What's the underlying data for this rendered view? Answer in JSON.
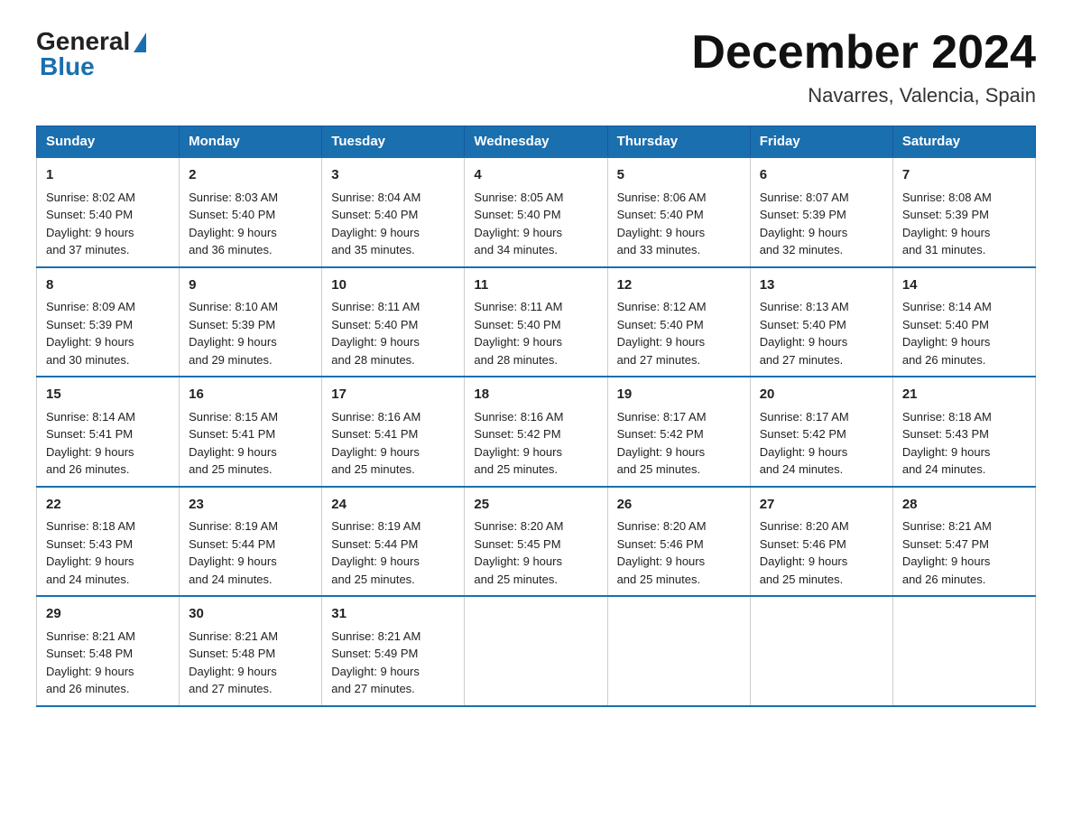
{
  "logo": {
    "general": "General",
    "blue": "Blue"
  },
  "title": {
    "month_year": "December 2024",
    "location": "Navarres, Valencia, Spain"
  },
  "headers": [
    "Sunday",
    "Monday",
    "Tuesday",
    "Wednesday",
    "Thursday",
    "Friday",
    "Saturday"
  ],
  "weeks": [
    [
      {
        "day": "1",
        "sunrise": "8:02 AM",
        "sunset": "5:40 PM",
        "daylight": "9 hours and 37 minutes."
      },
      {
        "day": "2",
        "sunrise": "8:03 AM",
        "sunset": "5:40 PM",
        "daylight": "9 hours and 36 minutes."
      },
      {
        "day": "3",
        "sunrise": "8:04 AM",
        "sunset": "5:40 PM",
        "daylight": "9 hours and 35 minutes."
      },
      {
        "day": "4",
        "sunrise": "8:05 AM",
        "sunset": "5:40 PM",
        "daylight": "9 hours and 34 minutes."
      },
      {
        "day": "5",
        "sunrise": "8:06 AM",
        "sunset": "5:40 PM",
        "daylight": "9 hours and 33 minutes."
      },
      {
        "day": "6",
        "sunrise": "8:07 AM",
        "sunset": "5:39 PM",
        "daylight": "9 hours and 32 minutes."
      },
      {
        "day": "7",
        "sunrise": "8:08 AM",
        "sunset": "5:39 PM",
        "daylight": "9 hours and 31 minutes."
      }
    ],
    [
      {
        "day": "8",
        "sunrise": "8:09 AM",
        "sunset": "5:39 PM",
        "daylight": "9 hours and 30 minutes."
      },
      {
        "day": "9",
        "sunrise": "8:10 AM",
        "sunset": "5:39 PM",
        "daylight": "9 hours and 29 minutes."
      },
      {
        "day": "10",
        "sunrise": "8:11 AM",
        "sunset": "5:40 PM",
        "daylight": "9 hours and 28 minutes."
      },
      {
        "day": "11",
        "sunrise": "8:11 AM",
        "sunset": "5:40 PM",
        "daylight": "9 hours and 28 minutes."
      },
      {
        "day": "12",
        "sunrise": "8:12 AM",
        "sunset": "5:40 PM",
        "daylight": "9 hours and 27 minutes."
      },
      {
        "day": "13",
        "sunrise": "8:13 AM",
        "sunset": "5:40 PM",
        "daylight": "9 hours and 27 minutes."
      },
      {
        "day": "14",
        "sunrise": "8:14 AM",
        "sunset": "5:40 PM",
        "daylight": "9 hours and 26 minutes."
      }
    ],
    [
      {
        "day": "15",
        "sunrise": "8:14 AM",
        "sunset": "5:41 PM",
        "daylight": "9 hours and 26 minutes."
      },
      {
        "day": "16",
        "sunrise": "8:15 AM",
        "sunset": "5:41 PM",
        "daylight": "9 hours and 25 minutes."
      },
      {
        "day": "17",
        "sunrise": "8:16 AM",
        "sunset": "5:41 PM",
        "daylight": "9 hours and 25 minutes."
      },
      {
        "day": "18",
        "sunrise": "8:16 AM",
        "sunset": "5:42 PM",
        "daylight": "9 hours and 25 minutes."
      },
      {
        "day": "19",
        "sunrise": "8:17 AM",
        "sunset": "5:42 PM",
        "daylight": "9 hours and 25 minutes."
      },
      {
        "day": "20",
        "sunrise": "8:17 AM",
        "sunset": "5:42 PM",
        "daylight": "9 hours and 24 minutes."
      },
      {
        "day": "21",
        "sunrise": "8:18 AM",
        "sunset": "5:43 PM",
        "daylight": "9 hours and 24 minutes."
      }
    ],
    [
      {
        "day": "22",
        "sunrise": "8:18 AM",
        "sunset": "5:43 PM",
        "daylight": "9 hours and 24 minutes."
      },
      {
        "day": "23",
        "sunrise": "8:19 AM",
        "sunset": "5:44 PM",
        "daylight": "9 hours and 24 minutes."
      },
      {
        "day": "24",
        "sunrise": "8:19 AM",
        "sunset": "5:44 PM",
        "daylight": "9 hours and 25 minutes."
      },
      {
        "day": "25",
        "sunrise": "8:20 AM",
        "sunset": "5:45 PM",
        "daylight": "9 hours and 25 minutes."
      },
      {
        "day": "26",
        "sunrise": "8:20 AM",
        "sunset": "5:46 PM",
        "daylight": "9 hours and 25 minutes."
      },
      {
        "day": "27",
        "sunrise": "8:20 AM",
        "sunset": "5:46 PM",
        "daylight": "9 hours and 25 minutes."
      },
      {
        "day": "28",
        "sunrise": "8:21 AM",
        "sunset": "5:47 PM",
        "daylight": "9 hours and 26 minutes."
      }
    ],
    [
      {
        "day": "29",
        "sunrise": "8:21 AM",
        "sunset": "5:48 PM",
        "daylight": "9 hours and 26 minutes."
      },
      {
        "day": "30",
        "sunrise": "8:21 AM",
        "sunset": "5:48 PM",
        "daylight": "9 hours and 27 minutes."
      },
      {
        "day": "31",
        "sunrise": "8:21 AM",
        "sunset": "5:49 PM",
        "daylight": "9 hours and 27 minutes."
      },
      null,
      null,
      null,
      null
    ]
  ],
  "labels": {
    "sunrise": "Sunrise:",
    "sunset": "Sunset:",
    "daylight": "Daylight:"
  }
}
